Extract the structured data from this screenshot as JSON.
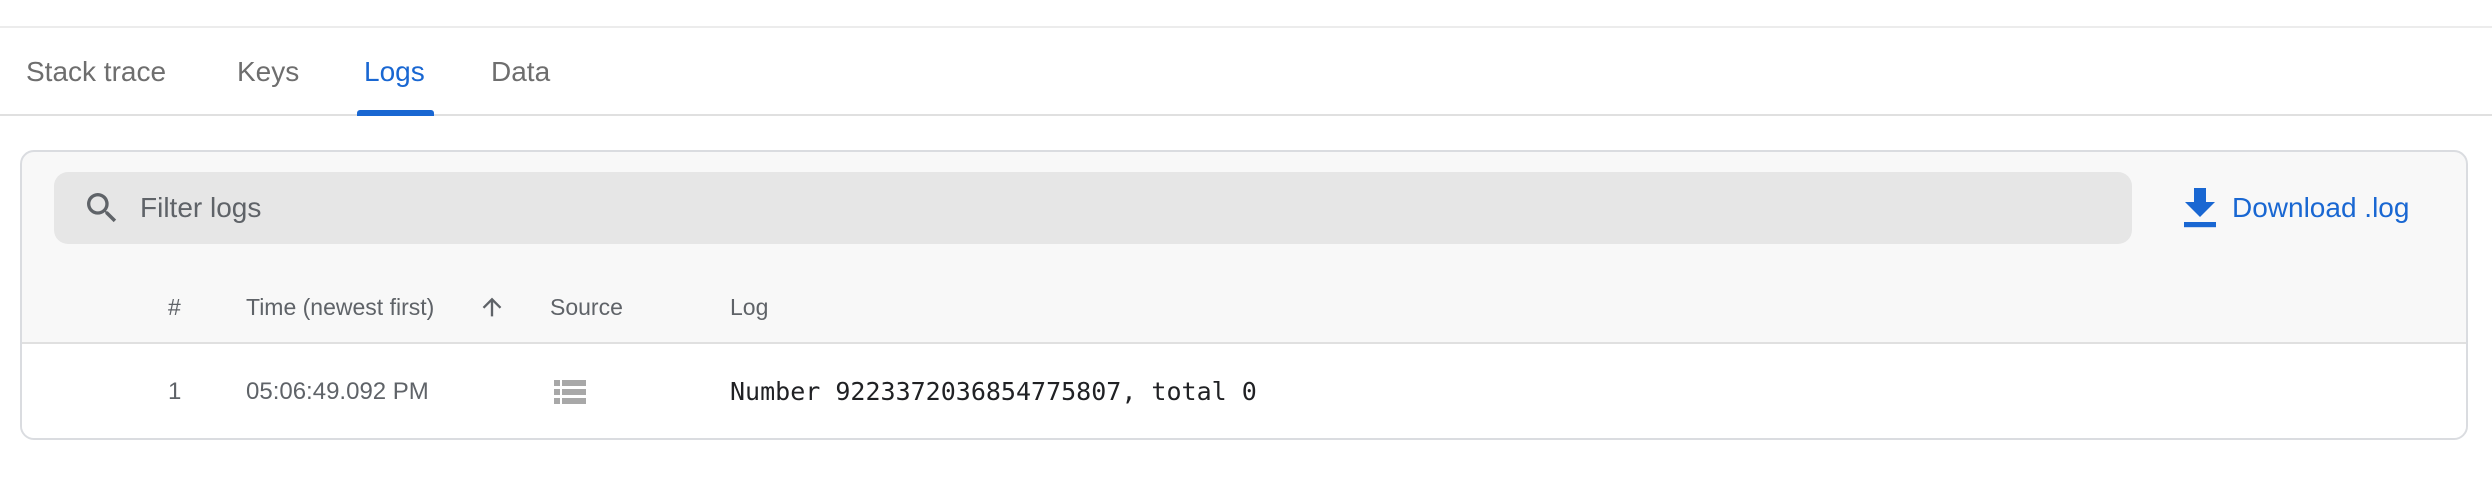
{
  "tabs": [
    {
      "label": "Stack trace",
      "active": false
    },
    {
      "label": "Keys",
      "active": false
    },
    {
      "label": "Logs",
      "active": true
    },
    {
      "label": "Data",
      "active": false
    }
  ],
  "filter": {
    "placeholder": "Filter logs",
    "value": "",
    "icon": "search-icon"
  },
  "download": {
    "label": "Download .log",
    "icon": "download-icon"
  },
  "table": {
    "columns": {
      "index": "#",
      "time": "Time (newest first)",
      "source": "Source",
      "log": "Log"
    },
    "sort": {
      "column": "time",
      "direction": "ascending",
      "icon": "arrow-up-icon"
    },
    "rows": [
      {
        "index": "1",
        "time": "05:06:49.092 PM",
        "source_icon": "list-icon",
        "log": "Number 9223372036854775807, total 0"
      }
    ]
  },
  "colors": {
    "accent": "#1967d2",
    "panel_background": "#f8f8f8",
    "search_background": "#e6e6e6",
    "muted_text": "#5f6368"
  }
}
